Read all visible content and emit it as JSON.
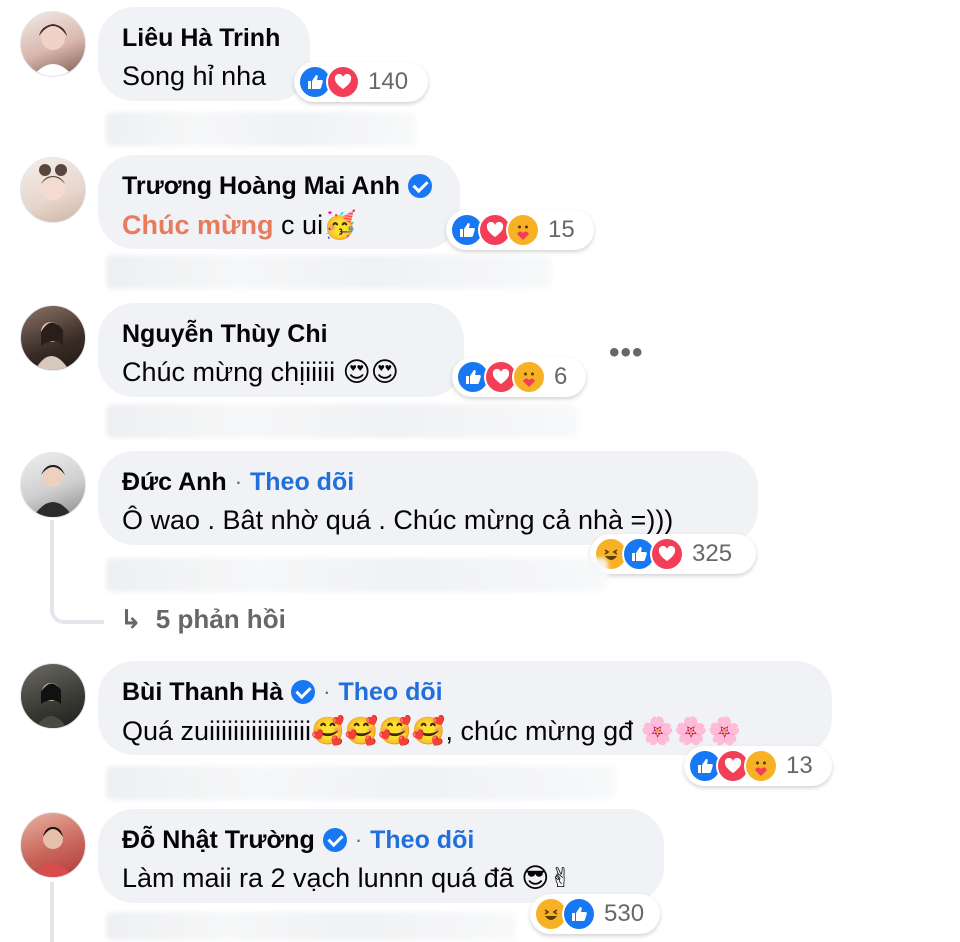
{
  "comments": [
    {
      "name": "Liêu Hà Trinh",
      "verified": false,
      "follow": "",
      "text": "Song hỉ nha",
      "reaction_count": "140",
      "reactions": [
        "like",
        "love"
      ]
    },
    {
      "name": "Trương Hoàng Mai Anh",
      "verified": true,
      "follow": "",
      "text_highlight": "Chúc mừng",
      "text": " c ui🥳",
      "reaction_count": "15",
      "reactions": [
        "like",
        "love",
        "care"
      ]
    },
    {
      "name": "Nguyễn Thùy Chi",
      "verified": false,
      "follow": "",
      "text": "Chúc mừng chịiiiii 😍😍",
      "reaction_count": "6",
      "reactions": [
        "like",
        "love",
        "care"
      ]
    },
    {
      "name": "Đức Anh",
      "verified": false,
      "follow": "Theo dõi",
      "text": "Ô wao . Bât nhờ quá . Chúc mừng cả nhà =)))",
      "reaction_count": "325",
      "reactions": [
        "haha",
        "like",
        "love"
      ]
    },
    {
      "name": "Bùi Thanh Hà",
      "verified": true,
      "follow": "Theo dõi",
      "text": "Quá zuiiiiiiiiiiiiiiiii🥰🥰🥰🥰, chúc mừng gđ 🌸🌸🌸",
      "reaction_count": "13",
      "reactions": [
        "like",
        "love",
        "care"
      ]
    },
    {
      "name": "Đỗ Nhật Trường",
      "verified": true,
      "follow": "Theo dõi",
      "text": "Làm maii ra 2 vạch lunnn quá đã 😎✌",
      "reaction_count": "530",
      "reactions": [
        "haha",
        "like"
      ]
    }
  ],
  "replies": {
    "label": "5 phản hồi"
  },
  "separator": "·",
  "more_menu": "•••",
  "icons": [
    "like-icon",
    "love-icon",
    "care-icon",
    "haha-icon",
    "reply-arrow-icon",
    "verified-icon",
    "more-options-icon"
  ]
}
